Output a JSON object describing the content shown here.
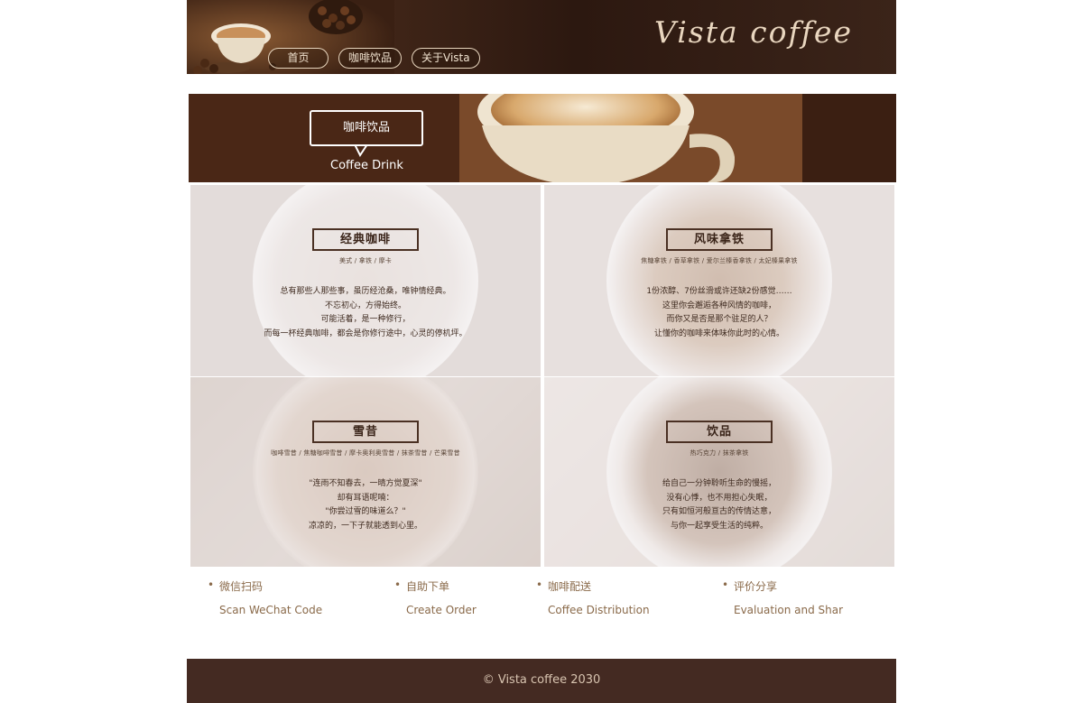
{
  "header": {
    "brand": "Vista coffee",
    "nav": [
      {
        "label": "首页"
      },
      {
        "label": "咖啡饮品"
      },
      {
        "label": "关于Vista"
      }
    ]
  },
  "banner": {
    "title": "咖啡饮品",
    "subtitle": "Coffee Drink"
  },
  "cards": [
    {
      "title": "经典咖啡",
      "variants": "美式 / 拿铁 / 摩卡",
      "lines": [
        "总有那些人那些事，虽历经沧桑，唯钟情经典。",
        "不忘初心，方得始终。",
        "可能活着，是一种修行，",
        "而每一杯经典咖啡，都会是你修行途中，心灵的停机坪。"
      ]
    },
    {
      "title": "风味拿铁",
      "variants": "焦糖拿铁 / 香草拿铁 / 爱尔兰榛香拿铁 / 太妃榛果拿铁",
      "lines": [
        "1份浓醇、7份丝滑或许还缺2份感觉……",
        "这里你会邂逅各种风情的咖啡，",
        "而你又是否是那个驻足的人？",
        "让懂你的咖啡来体味你此时的心情。"
      ]
    },
    {
      "title": "雪昔",
      "variants": "咖啡雪昔 / 焦糖咖啡雪昔 / 摩卡奥利奥雪昔 / 抹茶雪昔 / 芒果雪昔",
      "lines": [
        "\"连雨不知春去，一晴方觉夏深\"",
        "却有耳语呢喃：",
        "\"你尝过雪的味道么？\"",
        "凉凉的，一下子就能透到心里。"
      ]
    },
    {
      "title": "饮品",
      "variants": "热巧克力 / 抹茶拿铁",
      "lines": [
        "给自己一分钟聆听生命的慢摇，",
        "没有心悸，也不用担心失眠，",
        "只有如恒河般亘古的传情达意，",
        "与你一起享受生活的纯粹。"
      ]
    }
  ],
  "features": [
    {
      "cn": "微信扫码",
      "en": "Scan WeChat Code"
    },
    {
      "cn": "自助下单",
      "en": "Create Order"
    },
    {
      "cn": "咖啡配送",
      "en": "Coffee Distribution"
    },
    {
      "cn": "评价分享",
      "en": "Evaluation and Shar"
    }
  ],
  "footer": {
    "copyright": "© Vista coffee 2030"
  },
  "colors": {
    "header_bg": "#2c1810",
    "footer_bg": "#442a22",
    "accent_text": "#8a6a4a",
    "brand_text": "#e9d6bf"
  }
}
